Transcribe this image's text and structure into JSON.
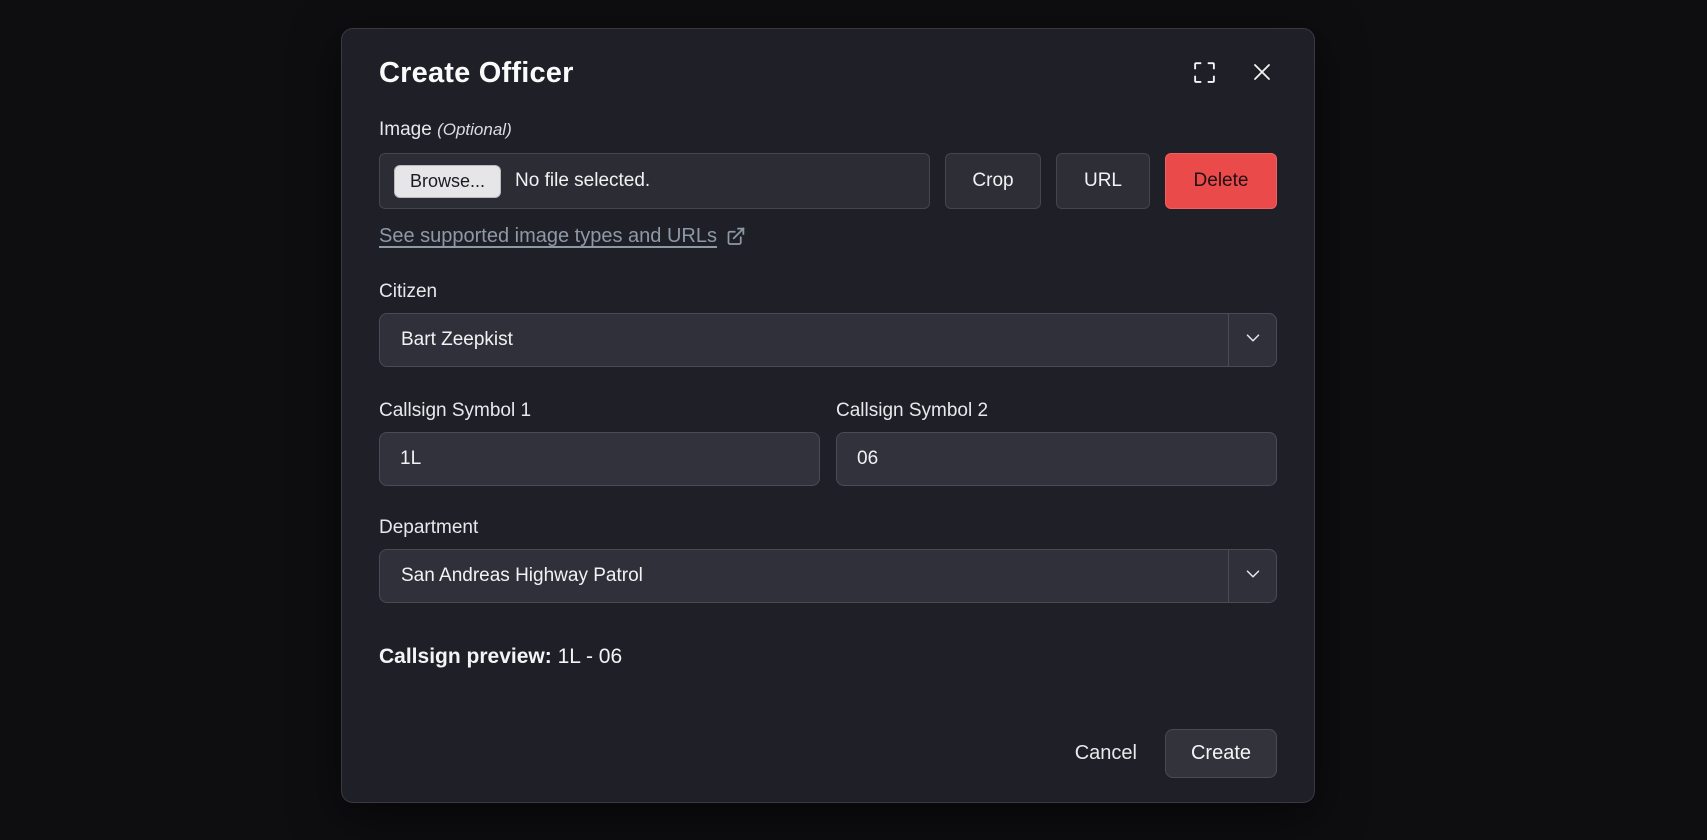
{
  "colors": {
    "page_bg": "#0e0e11",
    "modal_bg": "#1f1f27",
    "input_bg": "#32323c",
    "danger_red": "#ea4a4a",
    "link_gray": "#8e99a6"
  },
  "modal": {
    "title": "Create Officer",
    "image_field": {
      "label": "Image",
      "optional_tag": "(Optional)",
      "browse_label": "Browse...",
      "file_status": "No file selected.",
      "crop_label": "Crop",
      "url_label": "URL",
      "delete_label": "Delete",
      "supported_link_text": "See supported image types and URLs"
    },
    "citizen_field": {
      "label": "Citizen",
      "value": "Bart Zeepkist"
    },
    "callsign1_field": {
      "label": "Callsign Symbol 1",
      "value": "1L"
    },
    "callsign2_field": {
      "label": "Callsign Symbol 2",
      "value": "06"
    },
    "department_field": {
      "label": "Department",
      "value": "San Andreas Highway Patrol"
    },
    "preview": {
      "label": "Callsign preview:",
      "value": "1L - 06"
    },
    "footer": {
      "cancel_label": "Cancel",
      "create_label": "Create"
    }
  }
}
